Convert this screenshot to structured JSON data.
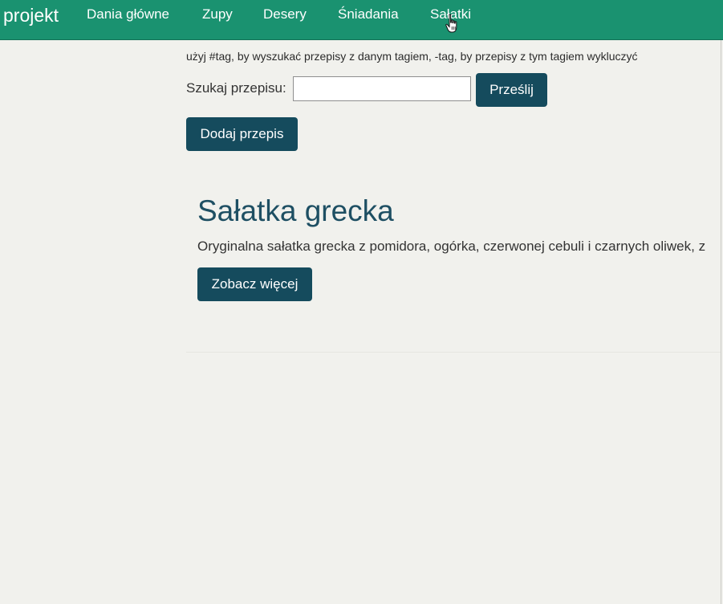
{
  "navbar": {
    "brand": "projekt",
    "items": [
      {
        "label": "Dania główne"
      },
      {
        "label": "Zupy"
      },
      {
        "label": "Desery"
      },
      {
        "label": "Śniadania"
      },
      {
        "label": "Sałatki"
      }
    ],
    "background_color": "#1a9270"
  },
  "search": {
    "hint": "użyj #tag, by wyszukać przepisy z danym tagiem, -tag, by przepisy z tym tagiem wykluczyć",
    "label": "Szukaj przepisu:",
    "value": "",
    "submit_label": "Prześlij"
  },
  "actions": {
    "add_recipe_label": "Dodaj przepis"
  },
  "recipes": [
    {
      "title": "Sałatka grecka",
      "description": "Oryginalna sałatka grecka z pomidora, ogórka, czerwonej cebuli i czarnych oliwek, z",
      "more_label": "Zobacz więcej"
    }
  ],
  "colors": {
    "button": "#154b5d",
    "title": "#1e4f63",
    "page_background": "#f1f1ed"
  },
  "icons": {
    "cursor": "hand-pointer-icon"
  }
}
